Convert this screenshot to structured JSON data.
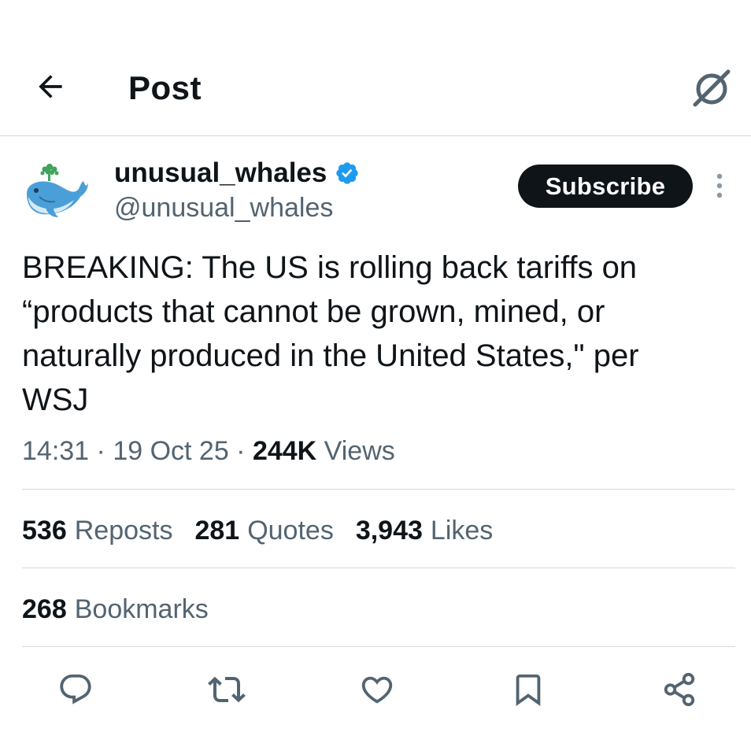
{
  "header": {
    "title": "Post",
    "back_icon": "arrow-left-icon",
    "grok_icon": "grok-icon"
  },
  "author": {
    "display_name": "unusual_whales",
    "handle": "@unusual_whales",
    "verified": true,
    "verified_color": "#1d9bf0",
    "subscribe_label": "Subscribe"
  },
  "tweet": {
    "text": "BREAKING: The US is rolling back tariffs on\n“products that cannot be grown, mined, or\nnaturally produced in the United States,\" per\nWSJ",
    "time": "14:31",
    "sep1": " · ",
    "date": "19 Oct 25",
    "sep2": " · ",
    "views_count": "244K",
    "views_label": " Views"
  },
  "stats": {
    "reposts_count": "536",
    "reposts_label": "Reposts",
    "quotes_count": "281",
    "quotes_label": "Quotes",
    "likes_count": "3,943",
    "likes_label": "Likes",
    "bookmarks_count": "268",
    "bookmarks_label": "Bookmarks"
  },
  "actions": {
    "icons": [
      "reply-icon",
      "retweet-icon",
      "like-icon",
      "bookmark-icon",
      "share-icon"
    ]
  },
  "colors": {
    "text_primary": "#0f1419",
    "text_secondary": "#536471",
    "divider": "#d6d9dc",
    "icon": "#536471"
  }
}
